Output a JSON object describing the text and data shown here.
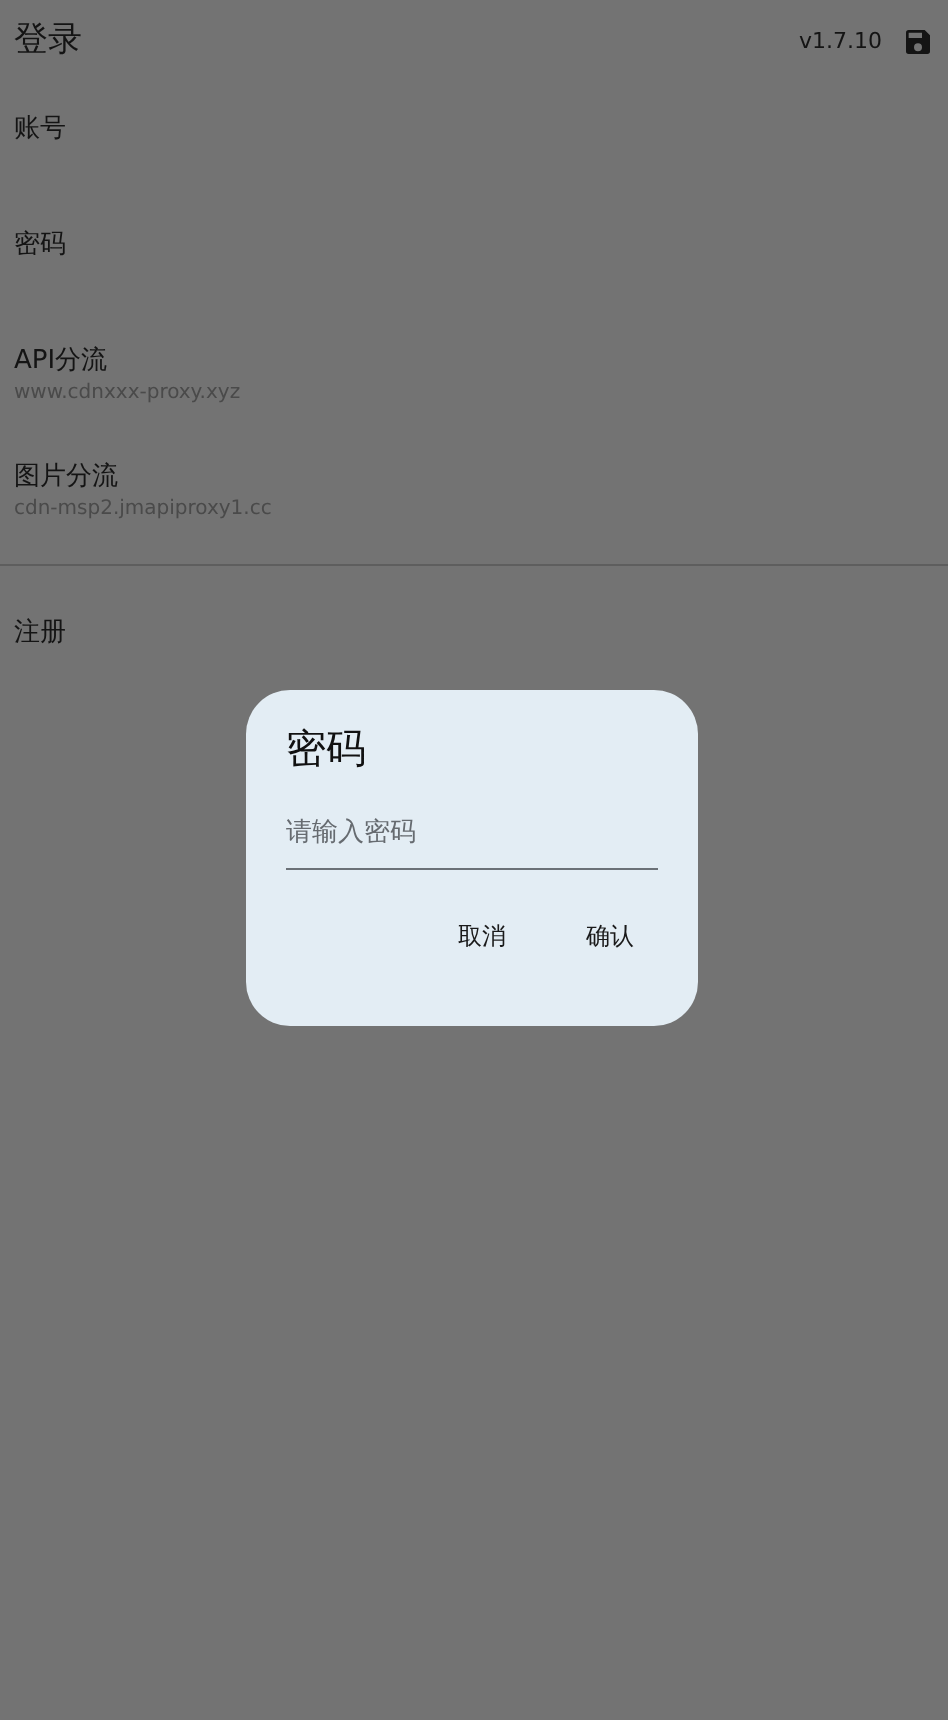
{
  "app_bar": {
    "title": "登录",
    "version": "v1.7.10"
  },
  "settings": [
    {
      "label": "账号"
    },
    {
      "label": "密码"
    },
    {
      "label": "API分流",
      "value": "www.cdnxxx-proxy.xyz"
    },
    {
      "label": "图片分流",
      "value": "cdn-msp2.jmapiproxy1.cc"
    }
  ],
  "register": "注册",
  "dialog": {
    "title": "密码",
    "placeholder": "请输入密码",
    "buttons": [
      "取消",
      "确认"
    ]
  }
}
